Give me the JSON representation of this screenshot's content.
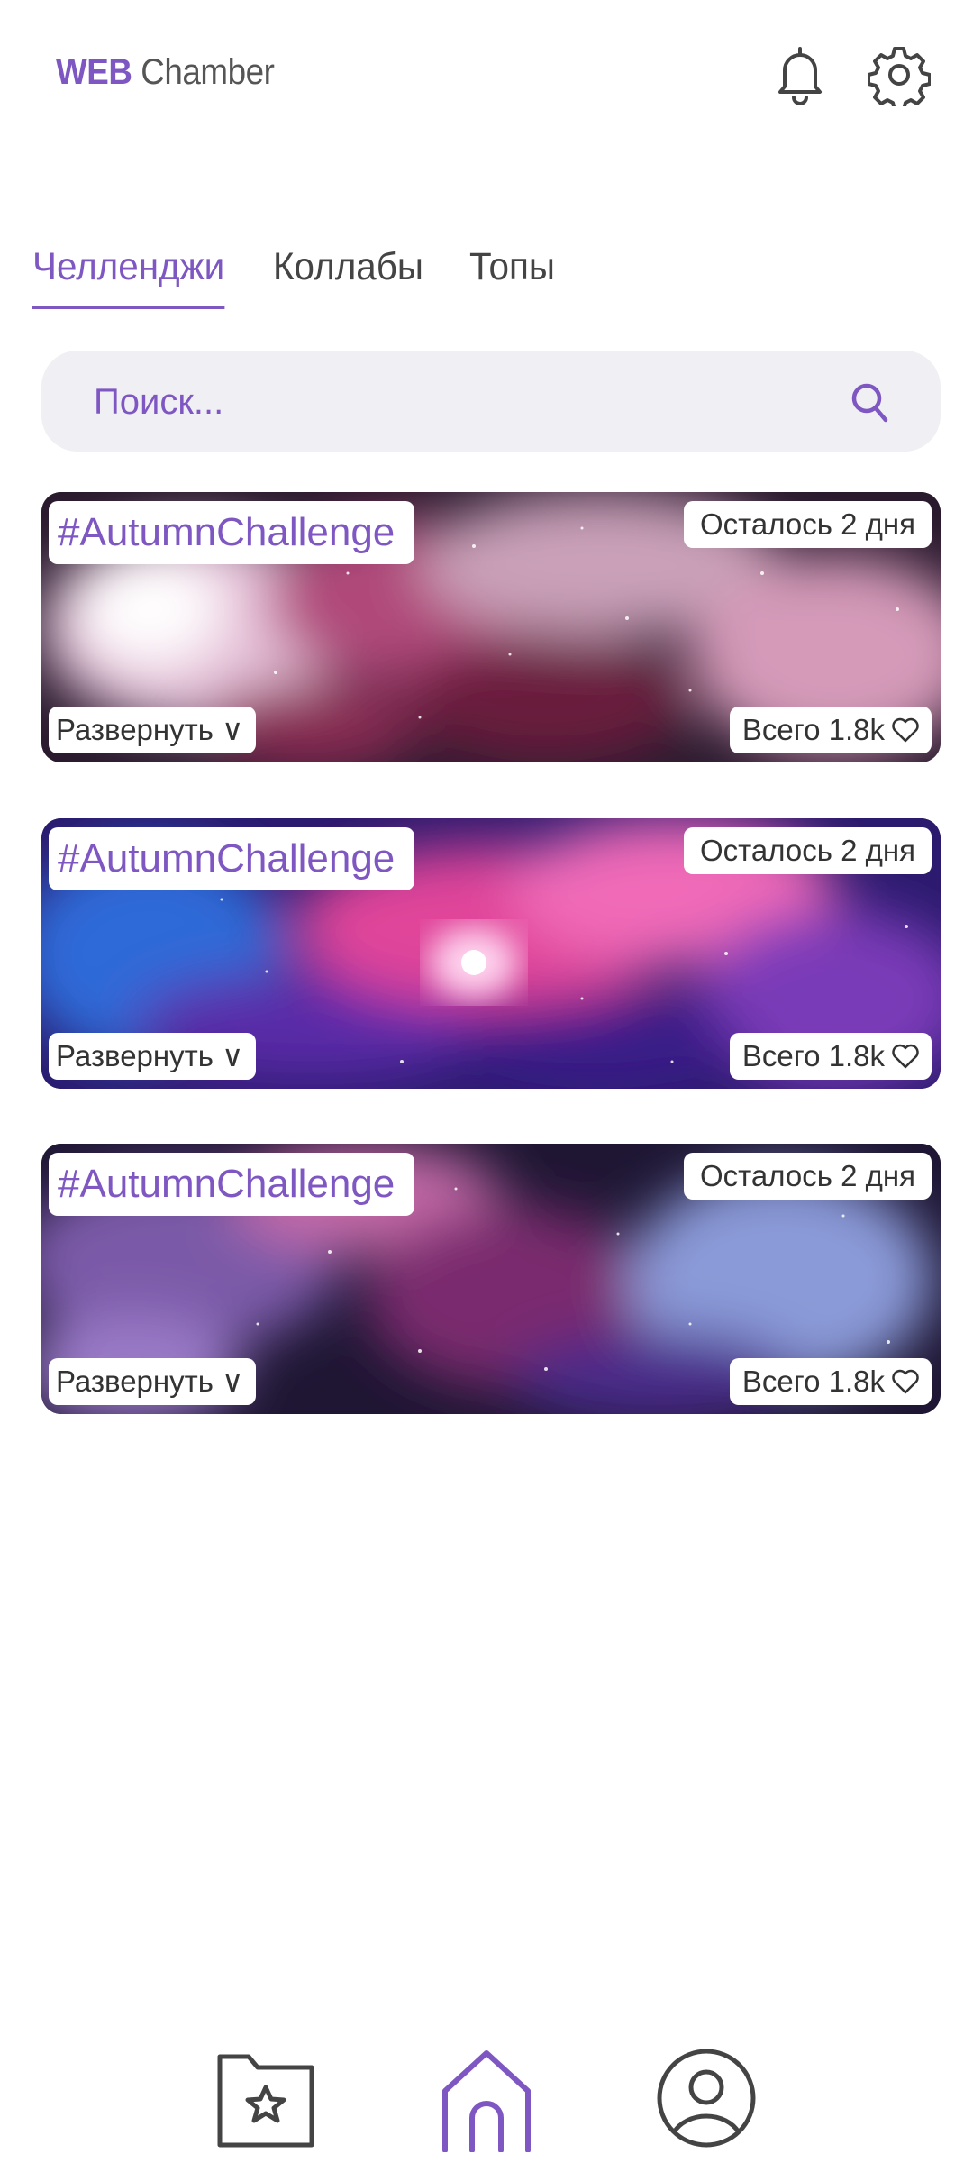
{
  "header": {
    "brand": "WEB",
    "title_rest": " Chamber",
    "icons": {
      "notifications": "bell-icon",
      "settings": "gear-icon"
    }
  },
  "tabs": [
    {
      "label": "Челленджи",
      "active": true
    },
    {
      "label": "Коллабы",
      "active": false
    },
    {
      "label": "Топы",
      "active": false
    }
  ],
  "search": {
    "placeholder": "Поиск...",
    "icon": "search-icon"
  },
  "cards": [
    {
      "hashtag": "#AutumnChallenge",
      "remaining": "Осталось 2 дня",
      "expand": "Развернуть ∨",
      "likes": "Всего 1.8k"
    },
    {
      "hashtag": "#AutumnChallenge",
      "remaining": "Осталось 2 дня",
      "expand": "Развернуть ∨",
      "likes": "Всего 1.8k"
    },
    {
      "hashtag": "#AutumnChallenge",
      "remaining": "Осталось 2 дня",
      "expand": "Развернуть ∨",
      "likes": "Всего 1.8k"
    }
  ],
  "bottom_nav": [
    {
      "icon": "folder-star-icon",
      "active": false
    },
    {
      "icon": "home-icon",
      "active": true
    },
    {
      "icon": "profile-icon",
      "active": false
    }
  ],
  "colors": {
    "accent": "#7e57c2",
    "search_bg": "#f0eff3",
    "text": "#333333"
  }
}
